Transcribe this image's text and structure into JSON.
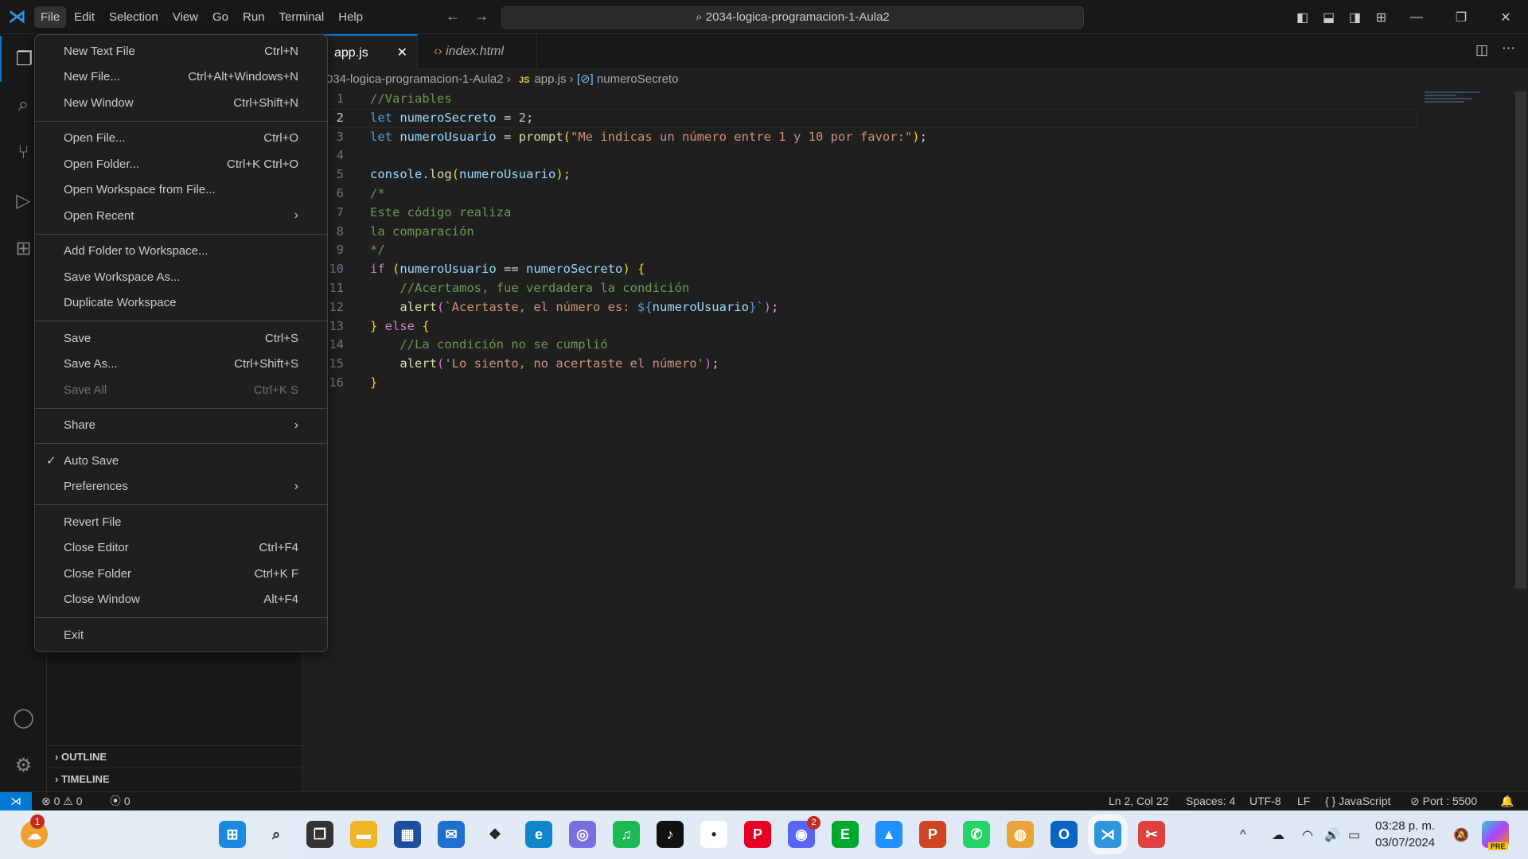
{
  "titlebar": {
    "menus": [
      "File",
      "Edit",
      "Selection",
      "View",
      "Go",
      "Run",
      "Terminal",
      "Help"
    ],
    "search": "2034-logica-programacion-1-Aula2"
  },
  "tabs": [
    {
      "label": "app.js",
      "active": true
    },
    {
      "label": "index.html",
      "active": false
    }
  ],
  "breadcrumb": {
    "folder": "034-logica-programacion-1-Aula2",
    "file_icon": "JS",
    "file": "app.js",
    "symbol": "numeroSecreto"
  },
  "sidebar": {
    "sections": [
      "OUTLINE",
      "TIMELINE"
    ]
  },
  "file_menu": {
    "groups": [
      [
        {
          "label": "New Text File",
          "shortcut": "Ctrl+N"
        },
        {
          "label": "New File...",
          "shortcut": "Ctrl+Alt+Windows+N"
        },
        {
          "label": "New Window",
          "shortcut": "Ctrl+Shift+N"
        }
      ],
      [
        {
          "label": "Open File...",
          "shortcut": "Ctrl+O"
        },
        {
          "label": "Open Folder...",
          "shortcut": "Ctrl+K Ctrl+O"
        },
        {
          "label": "Open Workspace from File...",
          "shortcut": ""
        },
        {
          "label": "Open Recent",
          "shortcut": "",
          "submenu": true
        }
      ],
      [
        {
          "label": "Add Folder to Workspace...",
          "shortcut": ""
        },
        {
          "label": "Save Workspace As...",
          "shortcut": ""
        },
        {
          "label": "Duplicate Workspace",
          "shortcut": ""
        }
      ],
      [
        {
          "label": "Save",
          "shortcut": "Ctrl+S"
        },
        {
          "label": "Save As...",
          "shortcut": "Ctrl+Shift+S"
        },
        {
          "label": "Save All",
          "shortcut": "Ctrl+K S",
          "disabled": true
        }
      ],
      [
        {
          "label": "Share",
          "shortcut": "",
          "submenu": true
        }
      ],
      [
        {
          "label": "Auto Save",
          "shortcut": "",
          "checked": true
        },
        {
          "label": "Preferences",
          "shortcut": "",
          "submenu": true
        }
      ],
      [
        {
          "label": "Revert File",
          "shortcut": ""
        },
        {
          "label": "Close Editor",
          "shortcut": "Ctrl+F4"
        },
        {
          "label": "Close Folder",
          "shortcut": "Ctrl+K F"
        },
        {
          "label": "Close Window",
          "shortcut": "Alt+F4"
        }
      ],
      [
        {
          "label": "Exit",
          "shortcut": ""
        }
      ]
    ]
  },
  "editor": {
    "current_line": 2,
    "lines": [
      [
        [
          "//Variables",
          "c"
        ]
      ],
      [
        [
          "let ",
          "k"
        ],
        [
          "numeroSecreto",
          "v"
        ],
        [
          " = ",
          "p"
        ],
        [
          "2",
          "n"
        ],
        [
          ";",
          "p"
        ]
      ],
      [
        [
          "let ",
          "k"
        ],
        [
          "numeroUsuario",
          "v"
        ],
        [
          " = ",
          "p"
        ],
        [
          "prompt",
          "f"
        ],
        [
          "(",
          "b"
        ],
        [
          "\"Me indicas un número entre 1 y 10 por favor:\"",
          "s"
        ],
        [
          ")",
          "b"
        ],
        [
          ";",
          "p"
        ]
      ],
      [],
      [
        [
          "console",
          "v"
        ],
        [
          ".",
          "p"
        ],
        [
          "log",
          "f"
        ],
        [
          "(",
          "b"
        ],
        [
          "numeroUsuario",
          "v"
        ],
        [
          ")",
          "b"
        ],
        [
          ";",
          "p"
        ]
      ],
      [
        [
          "/*",
          "c"
        ]
      ],
      [
        [
          "Este código realiza",
          "c"
        ]
      ],
      [
        [
          "la comparación",
          "c"
        ]
      ],
      [
        [
          "*/",
          "c"
        ]
      ],
      [
        [
          "if ",
          "kc"
        ],
        [
          "(",
          "b"
        ],
        [
          "numeroUsuario",
          "v"
        ],
        [
          " == ",
          "p"
        ],
        [
          "numeroSecreto",
          "v"
        ],
        [
          ")",
          "b"
        ],
        [
          " ",
          "p"
        ],
        [
          "{",
          "b"
        ]
      ],
      [
        [
          "    //Acertamos, fue verdadera la condición",
          "c"
        ]
      ],
      [
        [
          "    alert",
          "f"
        ],
        [
          "(",
          "b2"
        ],
        [
          "`Acertaste, el número es: ",
          "s"
        ],
        [
          "${",
          "tb"
        ],
        [
          "numeroUsuario",
          "v"
        ],
        [
          "}",
          "tb"
        ],
        [
          "`",
          "s"
        ],
        [
          ")",
          "b2"
        ],
        [
          ";",
          "p"
        ]
      ],
      [
        [
          "}",
          "b"
        ],
        [
          " else ",
          "kc"
        ],
        [
          "{",
          "b"
        ]
      ],
      [
        [
          "    //La condición no se cumplió",
          "c"
        ]
      ],
      [
        [
          "    alert",
          "f"
        ],
        [
          "(",
          "b2"
        ],
        [
          "'Lo siento, no acertaste el número'",
          "s"
        ],
        [
          ")",
          "b2"
        ],
        [
          ";",
          "p"
        ]
      ],
      [
        [
          "}",
          "b"
        ]
      ]
    ]
  },
  "statusbar": {
    "errors": "0",
    "warnings": "0",
    "ports": "0",
    "position": "Ln 2, Col 22",
    "spaces": "Spaces: 4",
    "encoding": "UTF-8",
    "eol": "LF",
    "language": "JavaScript",
    "port": "Port : 5500"
  },
  "taskbar": {
    "weather_badge": "1",
    "discord_badge": "2",
    "time": "03:28 p. m.",
    "date": "03/07/2024",
    "copilot_badge": "PRE",
    "apps": [
      [
        "start-icon",
        "#1a8ae0",
        "⊞"
      ],
      [
        "search-icon",
        "transparent",
        "⌕"
      ],
      [
        "task-view-icon",
        "#333",
        "❐"
      ],
      [
        "file-explorer-icon",
        "#f0b429",
        "▬"
      ],
      [
        "store-icon",
        "#1c4f9c",
        "▦"
      ],
      [
        "mail-icon",
        "#1e6fd0",
        "✉"
      ],
      [
        "dropbox-icon",
        "transparent",
        "❖"
      ],
      [
        "edge-icon",
        "#0f86c9",
        "e"
      ],
      [
        "copilot-app-icon",
        "#7a6fe0",
        "◎"
      ],
      [
        "spotify-icon",
        "#1db954",
        "♫"
      ],
      [
        "tiktok-icon",
        "#111",
        "♪"
      ],
      [
        "app-icon",
        "#fff",
        "•"
      ],
      [
        "pinterest-icon",
        "#e60023",
        "P"
      ],
      [
        "discord-icon",
        "#5865f2",
        "◉"
      ],
      [
        "evernote-icon",
        "#00a82d",
        "E"
      ],
      [
        "photos-icon",
        "#1e90ff",
        "▲"
      ],
      [
        "powerpoint-icon",
        "#d04423",
        "P"
      ],
      [
        "whatsapp-icon",
        "#25d366",
        "✆"
      ],
      [
        "chrome-icon",
        "#e9a53a",
        "◍"
      ],
      [
        "outlook-icon",
        "#0a64c2",
        "O"
      ],
      [
        "vscode-icon",
        "#2f95dc",
        "⋊"
      ],
      [
        "snipping-tool-icon",
        "#e04040",
        "✂"
      ]
    ]
  }
}
